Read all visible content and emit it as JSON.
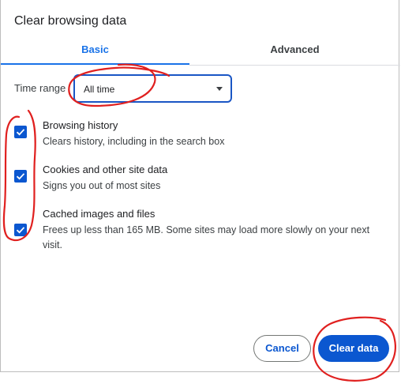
{
  "dialog": {
    "title": "Clear browsing data"
  },
  "tabs": [
    {
      "label": "Basic",
      "selected": true
    },
    {
      "label": "Advanced",
      "selected": false
    }
  ],
  "time_range": {
    "label": "Time range",
    "value": "All time"
  },
  "options": [
    {
      "title": "Browsing history",
      "description": "Clears history, including in the search box",
      "checked": true
    },
    {
      "title": "Cookies and other site data",
      "description": "Signs you out of most sites",
      "checked": true
    },
    {
      "title": "Cached images and files",
      "description": "Frees up less than 165 MB. Some sites may load more slowly on your next visit.",
      "checked": true
    }
  ],
  "buttons": {
    "cancel": "Cancel",
    "clear": "Clear data"
  },
  "colors": {
    "accent": "#1a73e8",
    "checkbox": "#0b57d0",
    "annotation": "#e0201f"
  }
}
